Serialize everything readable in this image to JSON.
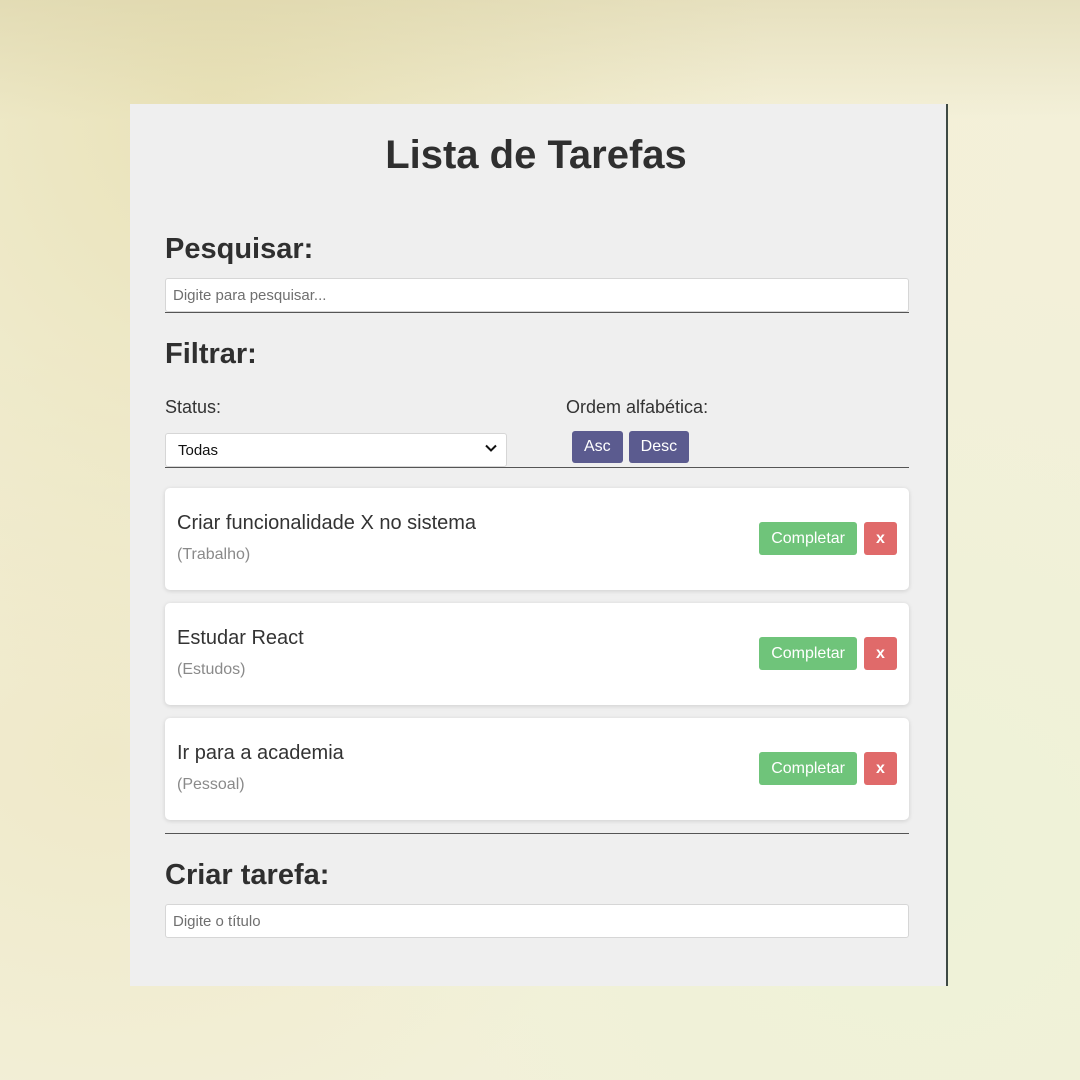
{
  "app": {
    "title": "Lista de Tarefas"
  },
  "search": {
    "heading": "Pesquisar:",
    "placeholder": "Digite para pesquisar...",
    "value": ""
  },
  "filter": {
    "heading": "Filtrar:",
    "status_label": "Status:",
    "status_selected": "Todas",
    "order_label": "Ordem alfabética:",
    "asc_label": "Asc",
    "desc_label": "Desc"
  },
  "tasks": [
    {
      "title": "Criar funcionalidade X no sistema",
      "category": "(Trabalho)",
      "complete_label": "Completar",
      "remove_label": "x"
    },
    {
      "title": "Estudar React",
      "category": "(Estudos)",
      "complete_label": "Completar",
      "remove_label": "x"
    },
    {
      "title": "Ir para a academia",
      "category": "(Pessoal)",
      "complete_label": "Completar",
      "remove_label": "x"
    }
  ],
  "create": {
    "heading": "Criar tarefa:",
    "title_placeholder": "Digite o título"
  },
  "icons": {
    "select_arrow": "chevron-down-icon"
  },
  "colors": {
    "order_button": "#5b5b8f",
    "complete_button": "#6fc47a",
    "remove_button": "#e06a6a",
    "panel_background": "#efefef"
  }
}
